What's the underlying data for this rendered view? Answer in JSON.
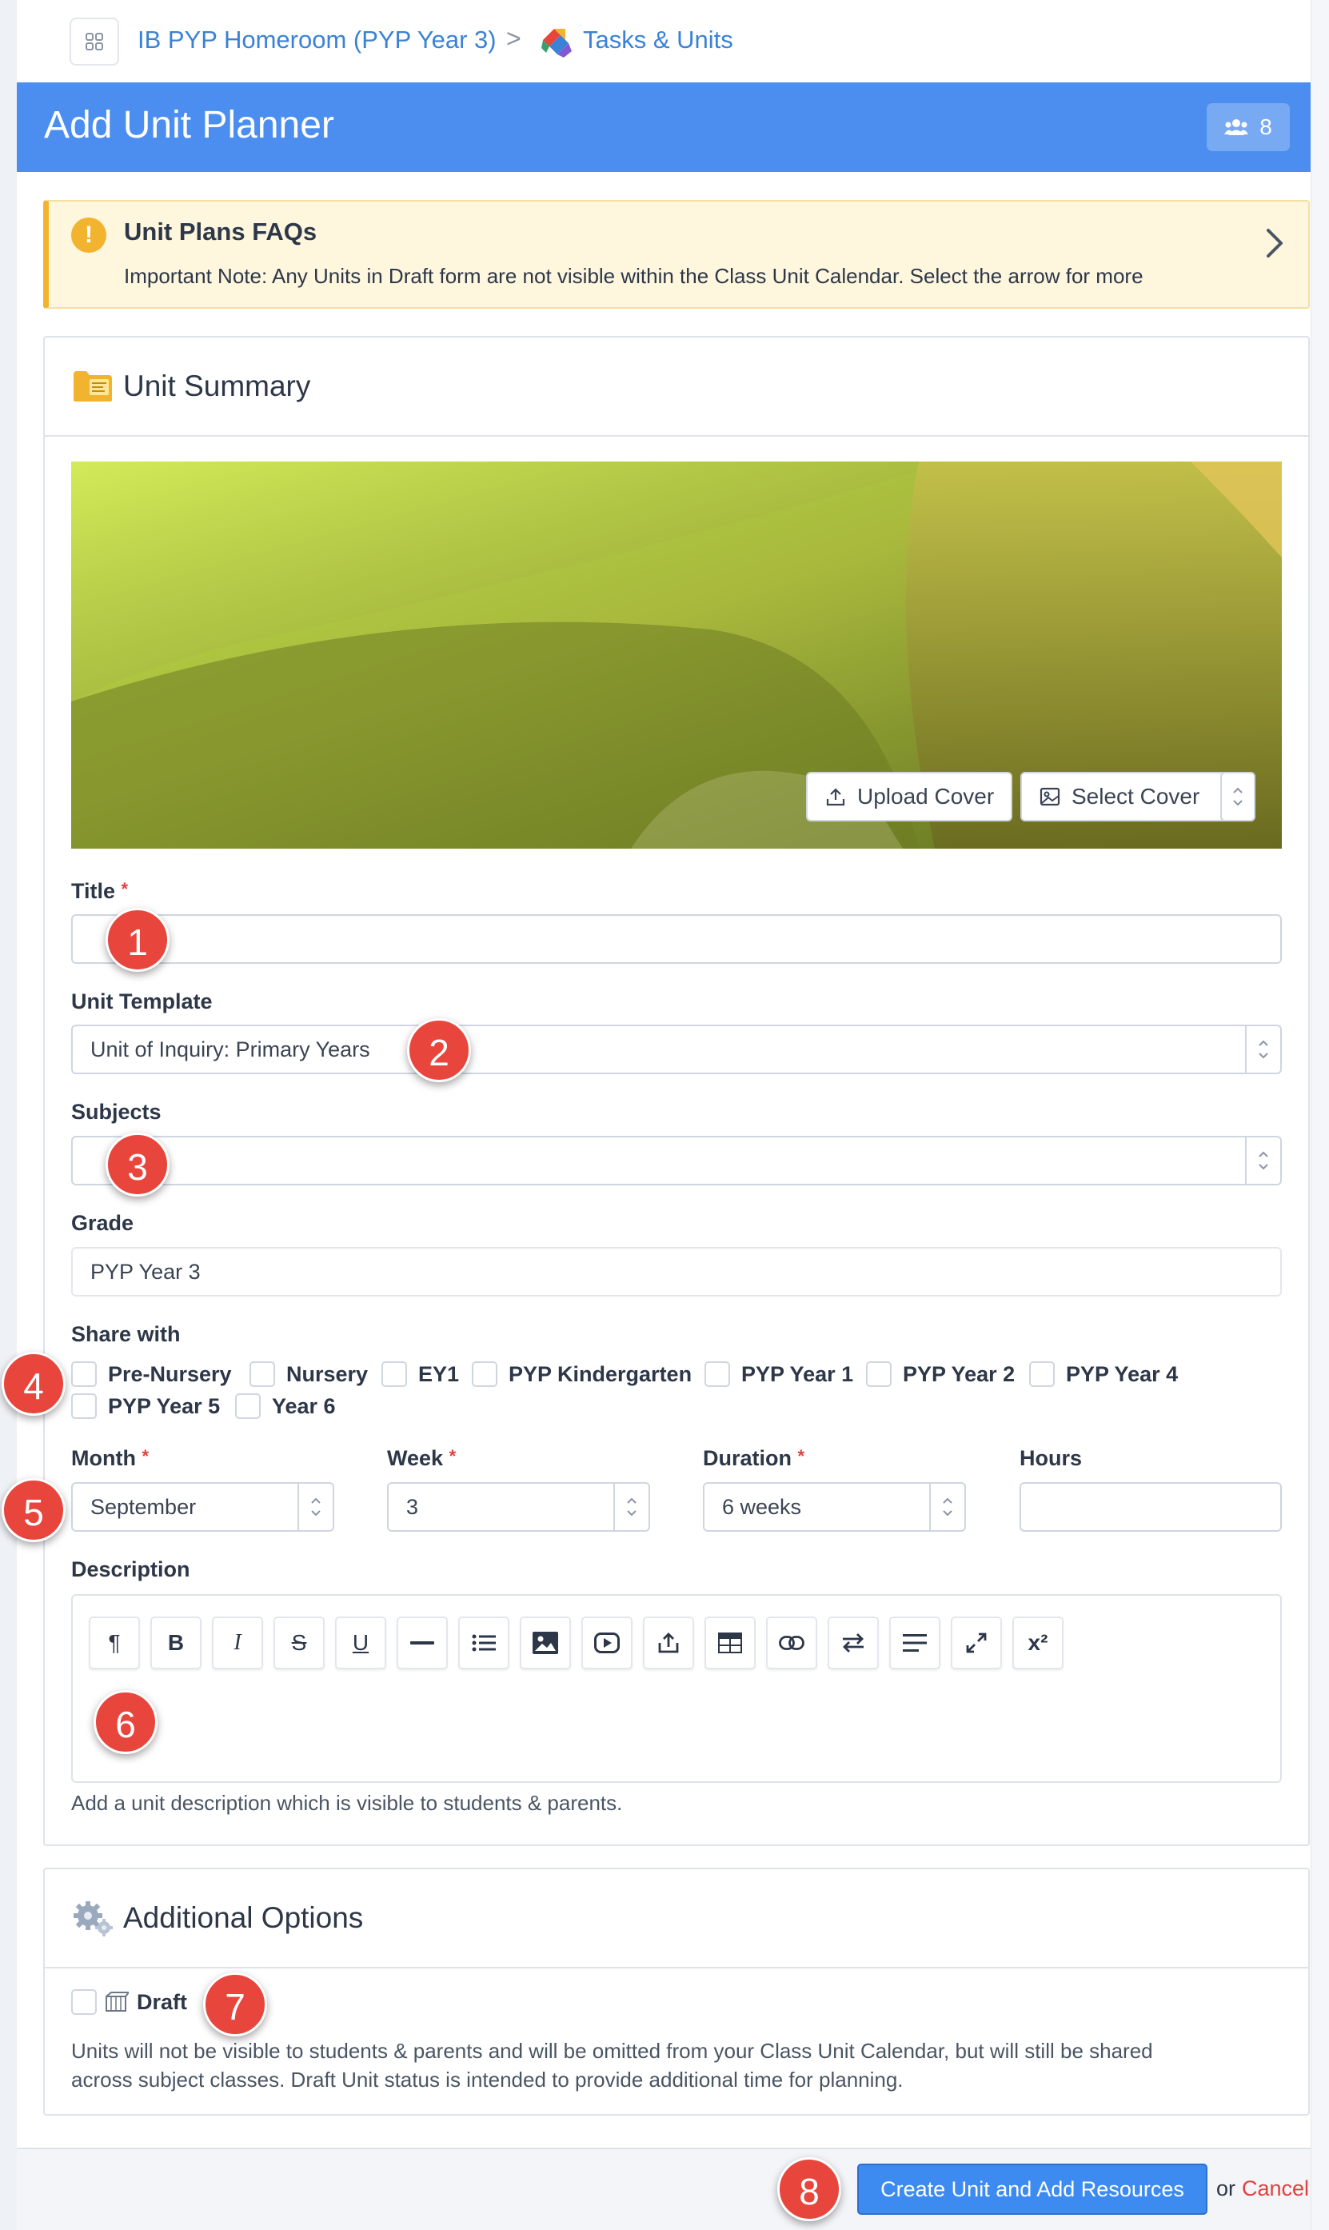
{
  "breadcrumb": {
    "class_name": "IB PYP Homeroom (PYP Year 3)",
    "separator": ">",
    "section": "Tasks & Units"
  },
  "header": {
    "title": "Add Unit Planner",
    "member_count": "8"
  },
  "faq": {
    "title": "Unit Plans FAQs",
    "text": "Important Note: Any Units in Draft form are not visible within the Class Unit Calendar. Select the arrow for more"
  },
  "summary": {
    "title": "Unit Summary",
    "upload_cover": "Upload Cover",
    "select_cover": "Select Cover"
  },
  "form": {
    "title_label": "Title",
    "title_value": "",
    "template_label": "Unit Template",
    "template_value": "Unit of Inquiry: Primary Years",
    "subjects_label": "Subjects",
    "subjects_value": "",
    "grade_label": "Grade",
    "grade_value": "PYP Year 3",
    "share_label": "Share with",
    "share_options": [
      "Pre-Nursery",
      "Nursery",
      "EY1",
      "PYP Kindergarten",
      "PYP Year 1",
      "PYP Year 2",
      "PYP Year 4",
      "PYP Year 5",
      "Year 6"
    ],
    "month_label": "Month",
    "month_value": "September",
    "week_label": "Week",
    "week_value": "3",
    "duration_label": "Duration",
    "duration_value": "6 weeks",
    "hours_label": "Hours",
    "hours_value": "",
    "description_label": "Description",
    "description_help": "Add a unit description which is visible to students & parents.",
    "required_mark": "*"
  },
  "additional": {
    "title": "Additional Options",
    "draft_label": "Draft",
    "draft_help_1": "Units will not be visible to students & parents and will be omitted from your Class Unit Calendar, but will still be shared",
    "draft_help_2": "across subject classes. Draft Unit status is intended to provide additional time for planning."
  },
  "footer": {
    "primary": "Create Unit and Add Resources",
    "or": "or",
    "cancel": "Cancel"
  },
  "markers": [
    "1",
    "2",
    "3",
    "4",
    "5",
    "6",
    "7",
    "8"
  ],
  "toolbar": {
    "superscript": "x²"
  },
  "colors": {
    "header_blue": "#4b8ef0",
    "link_blue": "#3b82d6",
    "warning_amber": "#f2b42e",
    "marker_red": "#e8453c",
    "cancel_red": "#e53e3e"
  }
}
